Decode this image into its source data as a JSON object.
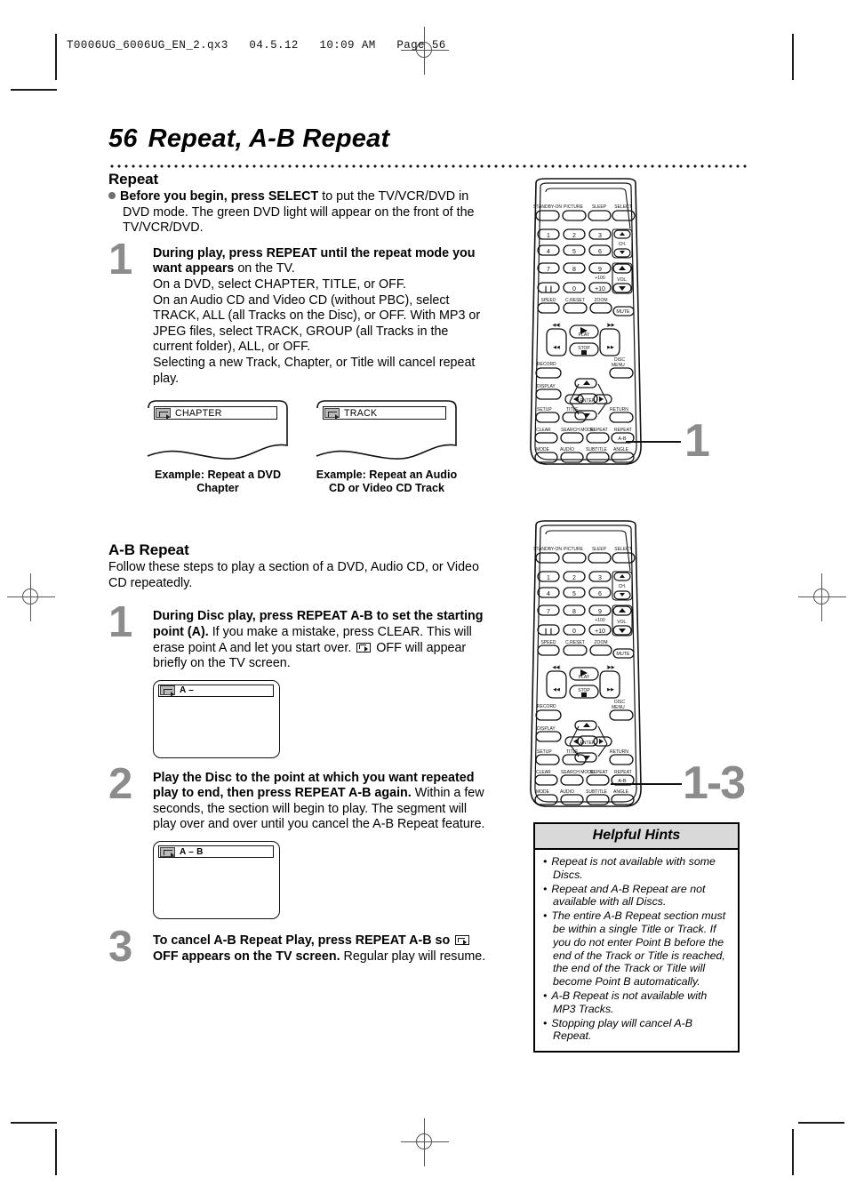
{
  "printer_slug": "T0006UG_6006UG_EN_2.qx3   04.5.12   10:09 AM   Page 56",
  "title": {
    "number": "56",
    "text": "Repeat, A-B Repeat"
  },
  "repeat_section": {
    "heading": "Repeat",
    "before_begin_bold": "Before you begin, press SELECT",
    "before_begin_rest": " to put the TV/VCR/DVD in DVD mode.  The green DVD light will appear on the front of the TV/VCR/DVD.",
    "step1": {
      "number": "1",
      "bold": "During play, press REPEAT until the repeat mode you want appears",
      "rest": " on the TV.",
      "lines": [
        "On a DVD, select CHAPTER, TITLE, or OFF.",
        "On an Audio CD and Video CD (without PBC), select TRACK, ALL (all Tracks on the Disc), or OFF. With MP3 or JPEG files, select TRACK, GROUP (all Tracks in the current folder), ALL, or OFF.",
        "Selecting a new Track, Chapter, or Title will cancel repeat play."
      ]
    },
    "examples": [
      {
        "osd_text": "CHAPTER",
        "caption": "Example: Repeat a DVD Chapter"
      },
      {
        "osd_text": "TRACK",
        "caption": "Example: Repeat an Audio CD or Video CD Track"
      }
    ]
  },
  "ab_repeat_section": {
    "heading": "A-B Repeat",
    "intro": "Follow these steps to play a section of a DVD,  Audio CD, or Video CD repeatedly.",
    "steps": [
      {
        "number": "1",
        "bold": "During Disc play, press REPEAT A-B to set the starting point (A).",
        "rest_a": "  If you make a mistake, press CLEAR.  This will erase point A and let you start over. ",
        "rest_b": " OFF will appear briefly on the TV screen.",
        "osd_text": "A –"
      },
      {
        "number": "2",
        "bold": "Play the Disc to the point at which you want repeated play to end, then press REPEAT A-B again.",
        "rest_a": " Within a few seconds, the section will begin to play. The segment will play over and over until you cancel the A-B Repeat feature.",
        "rest_b": "",
        "osd_text": "A – B"
      },
      {
        "number": "3",
        "bold_a": "To cancel A-B Repeat Play, press REPEAT A-B so ",
        "bold_b": " OFF appears on the TV screen.",
        "rest_a": "  Regular play will resume.",
        "osd_text": ""
      }
    ]
  },
  "remote": {
    "row_top": [
      "STANDBY-ON",
      "PICTURE",
      "SLEEP",
      "SELECT"
    ],
    "keypad": [
      "1",
      "2",
      "3",
      "4",
      "5",
      "6",
      "7",
      "8",
      "9",
      "Ⅱ",
      "0",
      "+10"
    ],
    "plus100_label": "+100",
    "ch_label": "CH.",
    "vol_label": "VOL.",
    "row_speed": [
      "SPEED",
      "C.RESET",
      "ZOOM"
    ],
    "mute_label": "MUTE",
    "play_label": "PLAY",
    "stop_label": "STOP",
    "record_label": "RECORD",
    "disc_menu_label": [
      "DISC",
      "MENU"
    ],
    "display_label": "DISPLAY",
    "enter_label": "ENTER",
    "setup_label": "SETUP",
    "title_label": "TITLE",
    "return_label": "RETURN",
    "clear_label": "CLEAR",
    "search_mode_label": "SEARCH MODE",
    "repeat_label": "REPEAT",
    "repeat_ab_label": "REPEAT",
    "ab_key_label": "A-B",
    "mode_label": "MODE",
    "audio_label": "AUDIO",
    "subtitle_label": "SUBTITLE",
    "angle_label": "ANGLE"
  },
  "callouts": {
    "top": "1",
    "bottom": "1-3"
  },
  "helpful_hints": {
    "title": "Helpful Hints",
    "items": [
      "Repeat is not available with some Discs.",
      "Repeat and A-B Repeat are not available with all Discs.",
      "The entire A-B Repeat section must be within a single Title or Track. If you do not enter Point B before the end of the Track or Title is reached, the end of the Track or Title will become Point B automatically.",
      "A-B Repeat is not available with MP3 Tracks.",
      "Stopping play will cancel A-B Repeat."
    ]
  }
}
